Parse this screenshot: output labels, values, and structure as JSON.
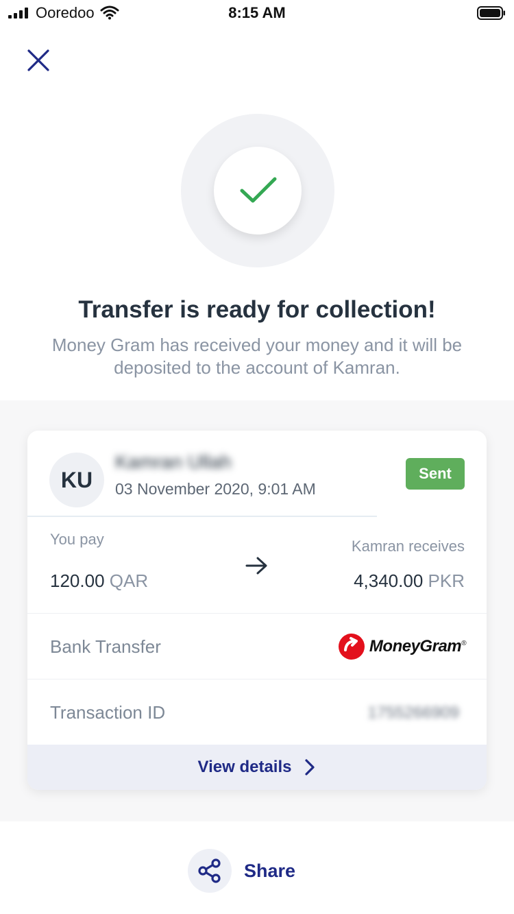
{
  "status_bar": {
    "carrier": "Ooredoo",
    "time": "8:15 AM"
  },
  "hero": {
    "title": "Transfer is ready for collection!",
    "subtitle": "Money Gram has received your money and it will be deposited to the account of Kamran."
  },
  "card": {
    "avatar_initials": "KU",
    "recipient_name": "Kamran Ullah",
    "date": "03 November 2020, 9:01 AM",
    "status_badge": "Sent",
    "you_pay_label": "You pay",
    "you_pay_amount": "120.00",
    "you_pay_currency": "QAR",
    "receives_label": "Kamran receives",
    "receives_amount": "4,340.00",
    "receives_currency": "PKR",
    "method_label": "Bank Transfer",
    "provider_name": "MoneyGram",
    "transaction_label": "Transaction ID",
    "transaction_id": "1755266909",
    "view_details_label": "View details"
  },
  "footer": {
    "share_label": "Share"
  },
  "colors": {
    "accent": "#1f2a86",
    "success": "#5fae5c",
    "check": "#34a853",
    "moneygram_red": "#e3101c"
  }
}
